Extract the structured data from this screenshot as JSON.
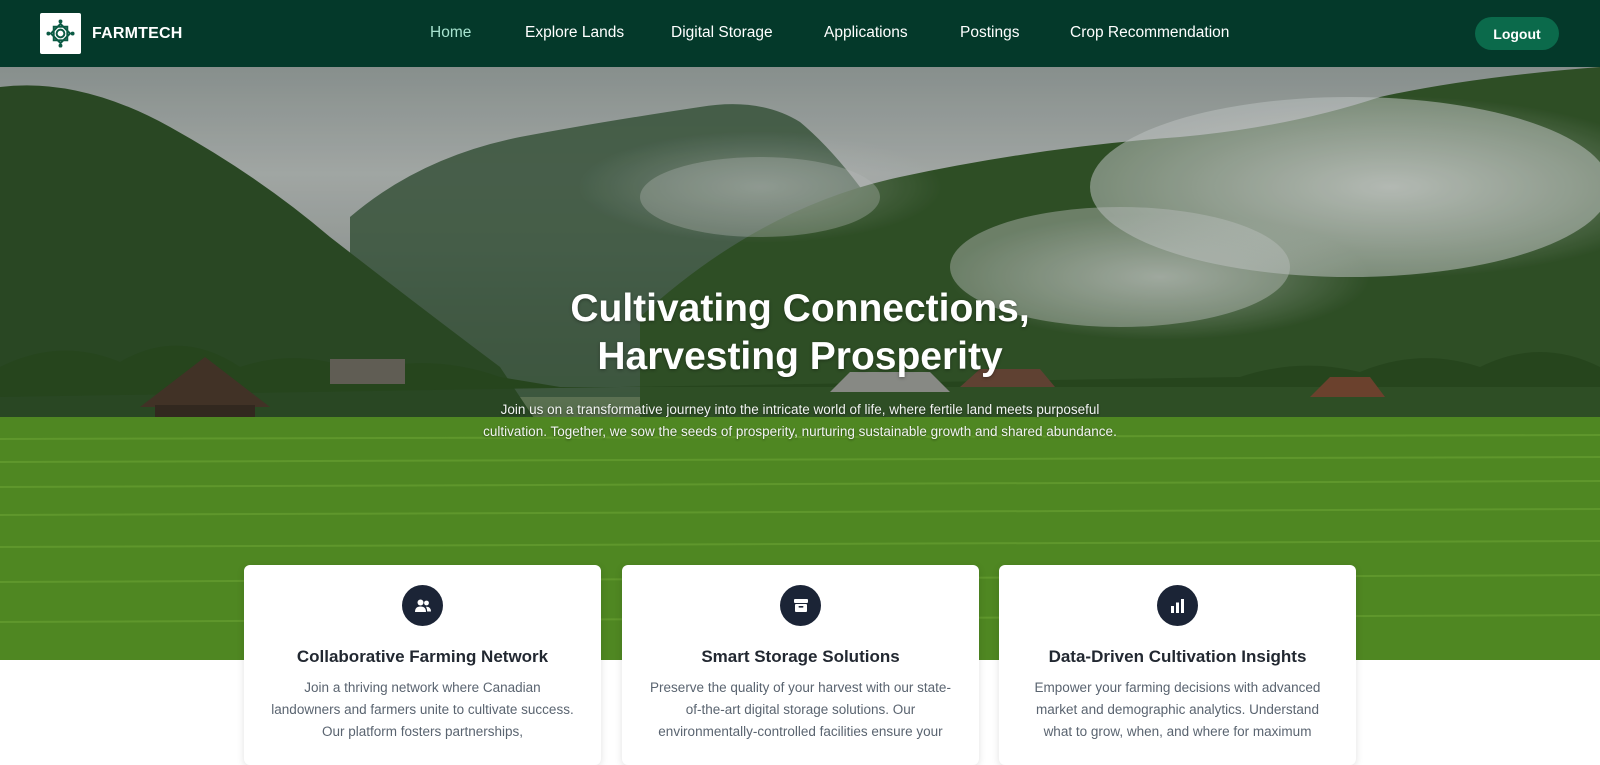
{
  "brand": {
    "name": "FARMTECH",
    "logo_icon": "lotus-knot-icon"
  },
  "nav": {
    "items": [
      {
        "label": "Home",
        "active": true
      },
      {
        "label": "Explore Lands",
        "active": false
      },
      {
        "label": "Digital Storage",
        "active": false
      },
      {
        "label": "Applications",
        "active": false
      },
      {
        "label": "Postings",
        "active": false
      },
      {
        "label": "Crop Recommendation",
        "active": false
      }
    ],
    "logout_label": "Logout"
  },
  "hero": {
    "title_line1": "Cultivating Connections,",
    "title_line2": "Harvesting Prosperity",
    "subtitle": "Join us on a transformative journey into the intricate world of life, where fertile land meets purposeful cultivation. Together, we sow the seeds of prosperity, nurturing sustainable growth and shared abundance."
  },
  "cards": [
    {
      "icon": "users-icon",
      "title": "Collaborative Farming Network",
      "text": "Join a thriving network where Canadian landowners and farmers unite to cultivate success. Our platform fosters partnerships,"
    },
    {
      "icon": "archive-box-icon",
      "title": "Smart Storage Solutions",
      "text": "Preserve the quality of your harvest with our state-of-the-art digital storage solutions. Our environmentally-controlled facilities ensure your"
    },
    {
      "icon": "bar-chart-icon",
      "title": "Data-Driven Cultivation Insights",
      "text": "Empower your farming decisions with advanced market and demographic analytics. Understand what to grow, when, and where for maximum"
    }
  ],
  "colors": {
    "nav_bg": "#04392a",
    "logout_bg": "#0b6a4b",
    "active_link": "#a7e3cf",
    "card_icon_bg": "#1b2436"
  }
}
